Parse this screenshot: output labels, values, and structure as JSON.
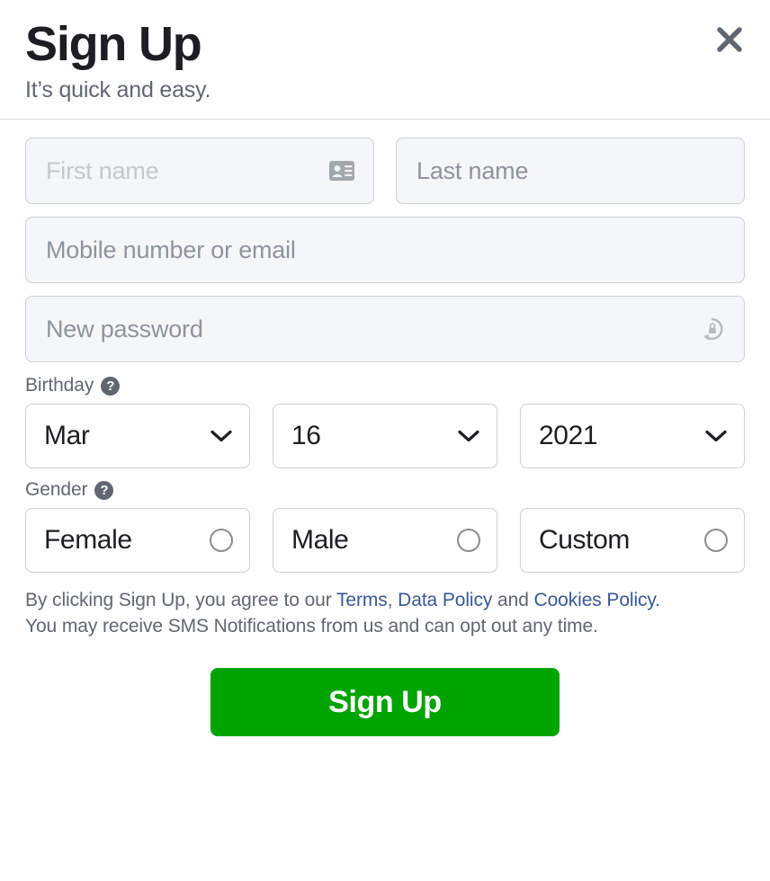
{
  "dialog": {
    "title": "Sign Up",
    "subtitle": "It’s quick and easy.",
    "close_label": "close-icon"
  },
  "fields": {
    "first_name": {
      "placeholder": "First name",
      "value": "",
      "icon": "contact-card-icon"
    },
    "last_name": {
      "placeholder": "Last name",
      "value": ""
    },
    "contact": {
      "placeholder": "Mobile number or email",
      "value": ""
    },
    "password": {
      "placeholder": "New password",
      "value": "",
      "icon": "password-key-icon"
    }
  },
  "birthday": {
    "label": "Birthday",
    "help_icon": "question-mark-icon",
    "month": {
      "value": "Mar",
      "caret": "chevron-down-icon"
    },
    "day": {
      "value": "16",
      "caret": "chevron-down-icon"
    },
    "year": {
      "value": "2021",
      "caret": "chevron-down-icon"
    }
  },
  "gender": {
    "label": "Gender",
    "help_icon": "question-mark-icon",
    "options": [
      {
        "label": "Female",
        "selected": false
      },
      {
        "label": "Male",
        "selected": false
      },
      {
        "label": "Custom",
        "selected": false
      }
    ]
  },
  "legal": {
    "line1_part1": "By clicking Sign Up, you agree to our ",
    "terms_link": "Terms",
    "sep1": ", ",
    "data_policy_link": "Data Policy",
    "sep2": " and ",
    "cookies_policy_link": "Cookies Policy.",
    "line2": "You may receive SMS Notifications from us and can opt out any time."
  },
  "submit": {
    "label": "Sign Up"
  },
  "colors": {
    "submit_green": "#00a400",
    "link_blue": "#385898",
    "text_dark": "#1c1e21",
    "text_gray": "#606770",
    "field_bg": "#f5f6f7",
    "border": "#ccd0d5"
  }
}
